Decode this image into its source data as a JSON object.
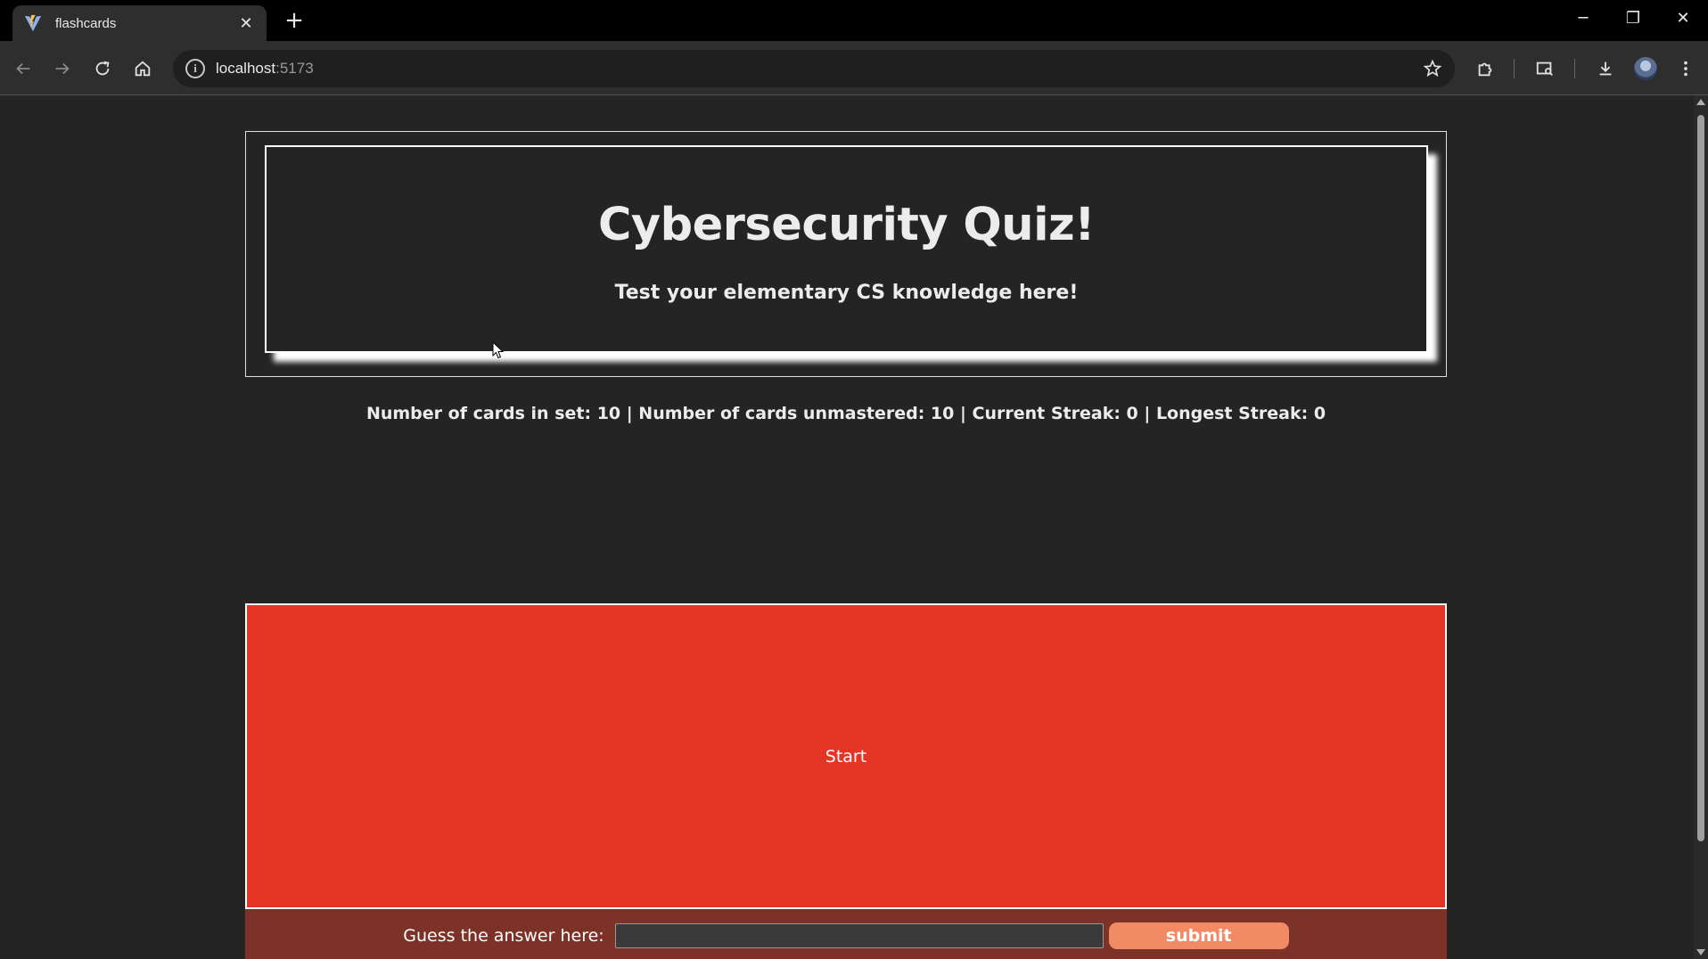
{
  "browser": {
    "tab_title": "flashcards",
    "url_host": "localhost",
    "url_port": ":5173",
    "icons": {
      "favicon": "vite-logo-icon",
      "back": "arrow-left-icon",
      "forward": "arrow-right-icon",
      "reload": "reload-icon",
      "home": "home-icon",
      "site_info": "info-icon",
      "bookmark": "star-icon",
      "extensions": "puzzle-icon",
      "tab_search": "tab-search-icon",
      "downloads": "download-icon",
      "menu": "kebab-menu-icon"
    }
  },
  "header": {
    "title": "Cybersecurity Quiz!",
    "subtitle": "Test your elementary CS knowledge here!"
  },
  "stats": {
    "text": "Number of cards in set: 10 | Number of cards unmastered: 10 | Current Streak: 0 | Longest Streak: 0"
  },
  "card": {
    "label": "Start",
    "color": "#e43424"
  },
  "guess": {
    "label": "Guess the answer here:",
    "value": "",
    "placeholder": "",
    "submit_label": "submit",
    "bar_color": "#7d3228",
    "button_color": "#f28a66"
  }
}
